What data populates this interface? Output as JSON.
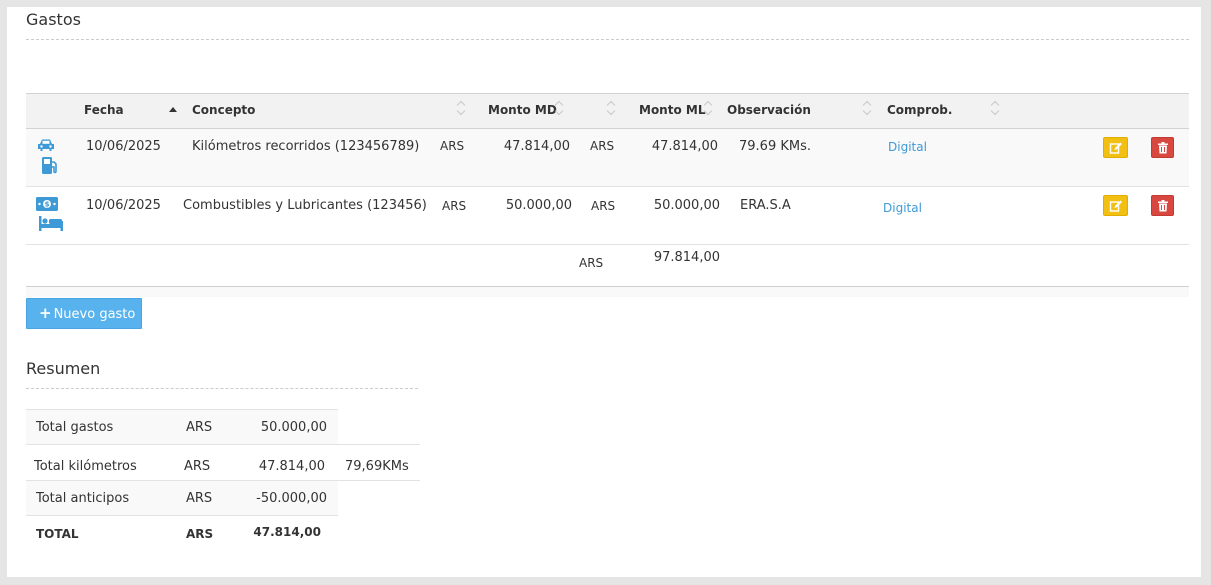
{
  "gastos": {
    "title": "Gastos",
    "columns": {
      "fecha": "Fecha",
      "concepto": "Concepto",
      "monto_md": "Monto MD",
      "monto_ml": "Monto ML",
      "observacion": "Observación",
      "comprob": "Comprob."
    },
    "rows": [
      {
        "icons": [
          "car-icon",
          "gas-pump-icon"
        ],
        "fecha": "10/06/2025",
        "concepto": "Kilómetros recorridos (123456789)",
        "moneda_md": "ARS",
        "monto_md": "47.814,00",
        "moneda_ml": "ARS",
        "monto_ml": "47.814,00",
        "observacion": "79.69 KMs.",
        "comprob": "Digital"
      },
      {
        "icons": [
          "money-icon",
          "bed-icon"
        ],
        "fecha": "10/06/2025",
        "concepto": "Combustibles y Lubricantes (123456)",
        "moneda_md": "ARS",
        "monto_md": "50.000,00",
        "moneda_ml": "ARS",
        "monto_ml": "50.000,00",
        "observacion": "ERA.S.A",
        "comprob": "Digital"
      }
    ],
    "total": {
      "moneda": "ARS",
      "monto": "97.814,00"
    },
    "nuevo_label": "Nuevo gasto",
    "nuevo_icon": "plus-icon"
  },
  "resumen": {
    "title": "Resumen",
    "rows": [
      {
        "label": "Total gastos",
        "moneda": "ARS",
        "monto": "50.000,00",
        "extra": ""
      },
      {
        "label": "Total kilómetros",
        "moneda": "ARS",
        "monto": "47.814,00",
        "extra": "79,69KMs"
      },
      {
        "label": "Total anticipos",
        "moneda": "ARS",
        "monto": "-50.000,00",
        "extra": ""
      },
      {
        "label": "TOTAL",
        "moneda": "ARS",
        "monto": "47.814,00",
        "extra": ""
      }
    ]
  },
  "colors": {
    "link": "#3e9ad6",
    "icon_blue": "#3e9ad6",
    "edit_button": "#f2c012",
    "delete_button": "#d84840",
    "primary_button": "#58b2ee"
  }
}
